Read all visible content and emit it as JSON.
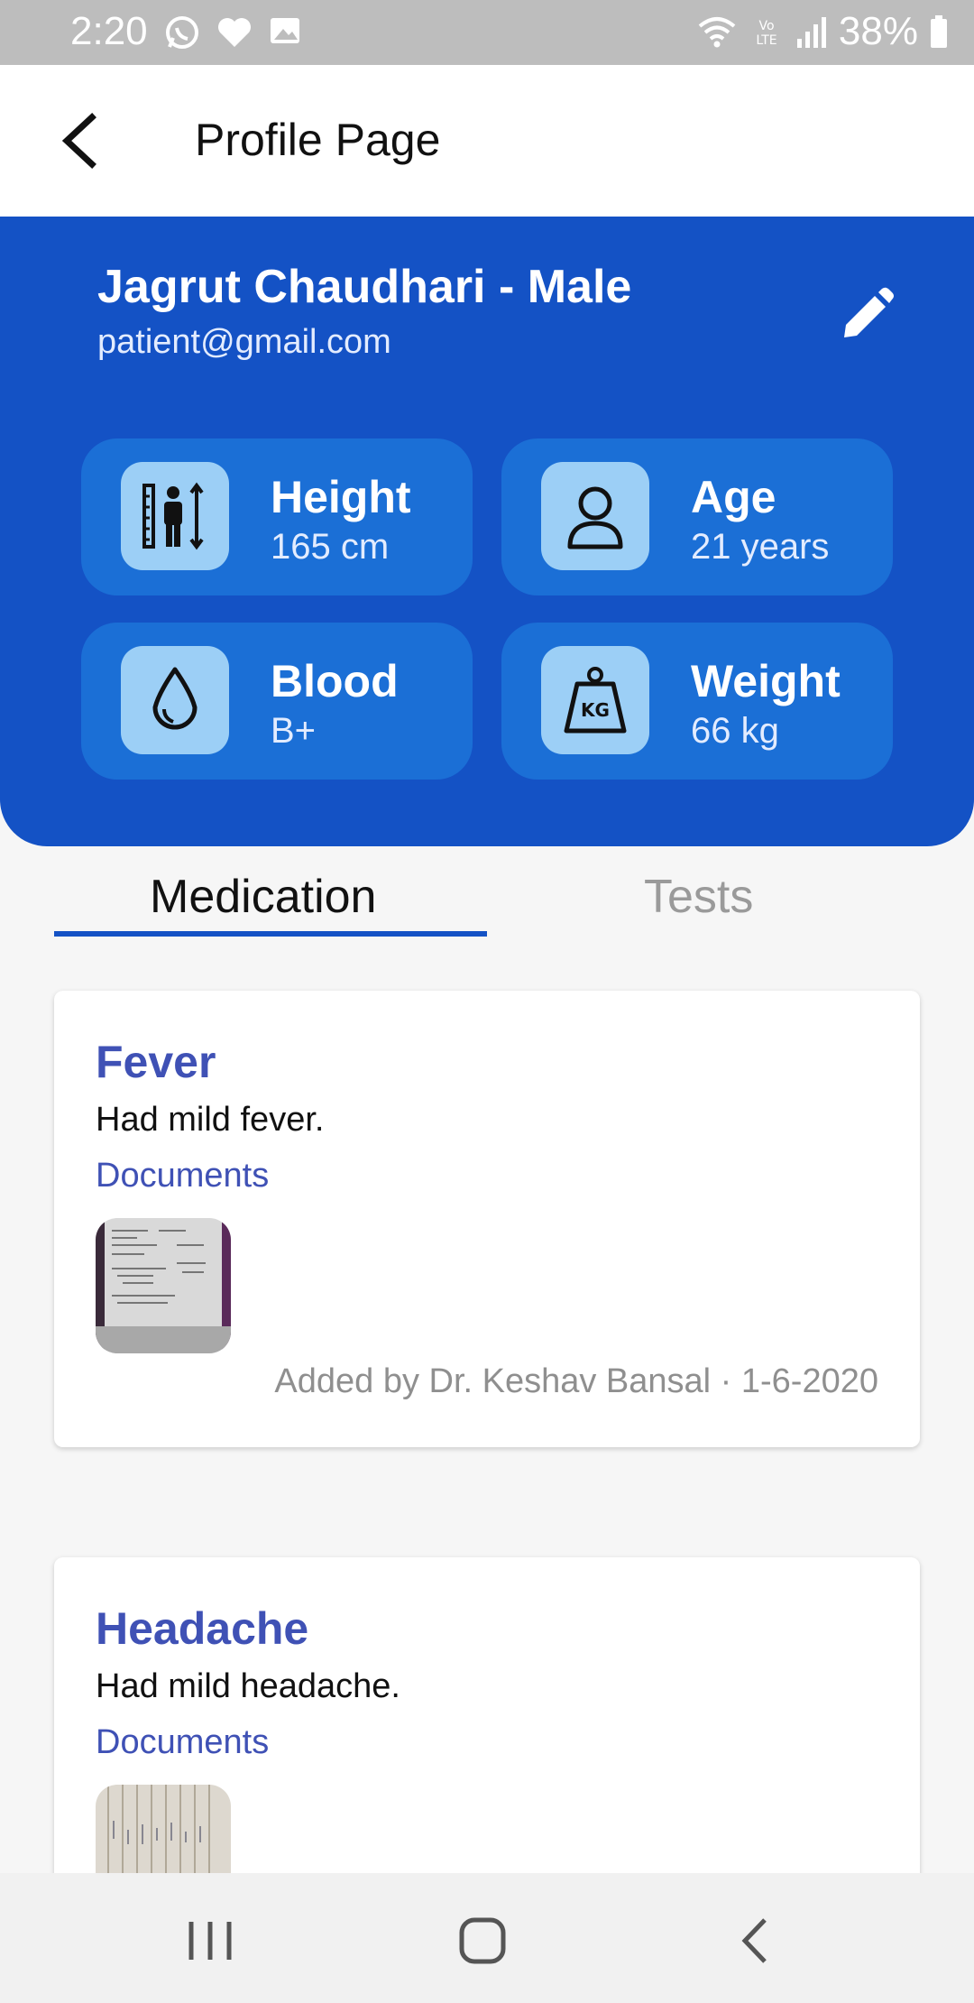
{
  "status_bar": {
    "time": "2:20",
    "battery": "38%",
    "left_icons": [
      "whatsapp-icon",
      "health-heart-icon",
      "gallery-icon"
    ],
    "right_icons": [
      "wifi-icon",
      "volte-icon",
      "signal-icon",
      "battery-icon"
    ]
  },
  "app_bar": {
    "title": "Profile Page",
    "back_icon": "back-arrow-icon"
  },
  "profile": {
    "name": "Jagrut Chaudhari - Male",
    "email": "patient@gmail.com",
    "edit_icon": "pencil-icon",
    "stats": [
      {
        "label": "Height",
        "value": "165 cm",
        "icon": "height-icon"
      },
      {
        "label": "Age",
        "value": "21 years",
        "icon": "person-icon"
      },
      {
        "label": "Blood",
        "value": "B+",
        "icon": "blood-drop-icon"
      },
      {
        "label": "Weight",
        "value": "66 kg",
        "icon": "weight-icon"
      }
    ]
  },
  "tabs": [
    {
      "label": "Medication",
      "selected": true
    },
    {
      "label": "Tests",
      "selected": false
    }
  ],
  "records": [
    {
      "title": "Fever",
      "description": "Had mild fever.",
      "documents_label": "Documents",
      "footer": "Added by Dr. Keshav Bansal · 1-6-2020"
    },
    {
      "title": "Headache",
      "description": "Had mild headache.",
      "documents_label": "Documents"
    }
  ],
  "nav_bar": [
    "recents-icon",
    "home-icon",
    "back-icon"
  ],
  "colors": {
    "primary": "#1452c5",
    "card_blue": "#1b6fd6",
    "icon_box": "#9ccff6",
    "title_indigo": "#3f51b5"
  }
}
